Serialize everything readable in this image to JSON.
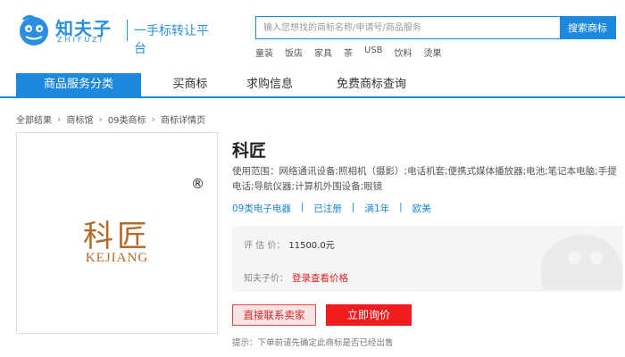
{
  "header": {
    "logo_cn": "知夫子",
    "logo_en": "ZHIFUZI",
    "slogan": "一手标转让平台",
    "search_placeholder": "输入您想找的商标名称/申请号/商品服务",
    "search_button": "搜索商标",
    "hot_words": [
      "童装",
      "饭店",
      "家具",
      "茶",
      "USB",
      "饮料",
      "烫果"
    ]
  },
  "nav": {
    "items": [
      "商品服务分类",
      "买商标",
      "求购信息",
      "免费商标查询"
    ],
    "active_index": 0
  },
  "breadcrumb": [
    "全部结果",
    "商标馆",
    "09类商标",
    "商标详情页"
  ],
  "trademark": {
    "image_cn": "科匠",
    "image_en": "KEJIANG",
    "registered_symbol": "®",
    "name": "科匠",
    "scope": "使用范围：网络通讯设备;照相机（摄影）;电话机套;便携式媒体播放器;电池;笔记本电脑;手提电话;导航仪器;计算机外围设备;眼镜",
    "tags": [
      "09类电子电器",
      "已注册",
      "满1年",
      "欧美"
    ],
    "eval_label": "评 估 价：",
    "eval_price": "11500.0元",
    "zfz_label": "知夫子价：",
    "zfz_link": "登录查看价格",
    "contact_button": "直接联系卖家",
    "ask_button": "立即询价",
    "tip": "提示：下单前请先确定此商标是否已经出售"
  },
  "colors": {
    "brand_blue": "#1c88de",
    "red": "#ee1c1c",
    "mark_brown": "#b56a2a"
  }
}
